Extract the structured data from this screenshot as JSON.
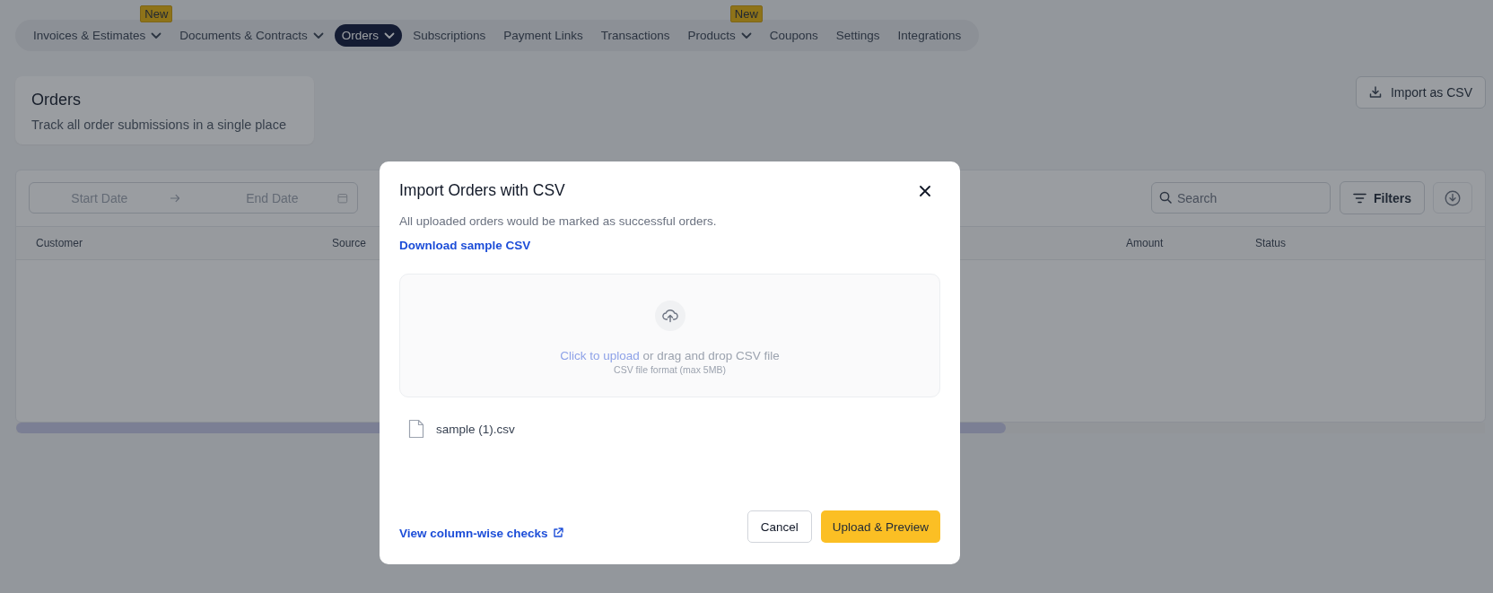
{
  "nav": {
    "items": [
      {
        "label": "Invoices & Estimates",
        "selected": false,
        "has_dropdown": true,
        "badge": "New"
      },
      {
        "label": "Documents & Contracts",
        "selected": false,
        "has_dropdown": true
      },
      {
        "label": "Orders",
        "selected": true,
        "has_dropdown": true
      },
      {
        "label": "Subscriptions",
        "selected": false,
        "has_dropdown": false
      },
      {
        "label": "Payment Links",
        "selected": false,
        "has_dropdown": false
      },
      {
        "label": "Transactions",
        "selected": false,
        "has_dropdown": false
      },
      {
        "label": "Products",
        "selected": false,
        "has_dropdown": true,
        "badge": "New"
      },
      {
        "label": "Coupons",
        "selected": false,
        "has_dropdown": false
      },
      {
        "label": "Settings",
        "selected": false,
        "has_dropdown": false
      },
      {
        "label": "Integrations",
        "selected": false,
        "has_dropdown": false
      }
    ]
  },
  "page_header": {
    "title": "Orders",
    "subtitle": "Track all order submissions in a single place"
  },
  "import_button": {
    "label": "Import as CSV"
  },
  "toolbar": {
    "date_range": {
      "start_placeholder": "Start Date",
      "end_placeholder": "End Date"
    },
    "search": {
      "placeholder": "Search"
    },
    "filters_button": {
      "label": "Filters"
    }
  },
  "table": {
    "columns": [
      "Customer",
      "Source",
      "Amount",
      "Status"
    ]
  },
  "modal": {
    "title": "Import Orders with CSV",
    "description": "All uploaded orders would be marked as successful orders.",
    "download_link": "Download sample CSV",
    "dropzone": {
      "action_link": "Click to upload",
      "action_text": "or drag and drop CSV file",
      "hint": "CSV file format (max 5MB)"
    },
    "file": {
      "name": "sample (1).csv"
    },
    "footer_link": "View column-wise checks",
    "cancel_button": "Cancel",
    "primary_button": "Upload & Preview"
  }
}
